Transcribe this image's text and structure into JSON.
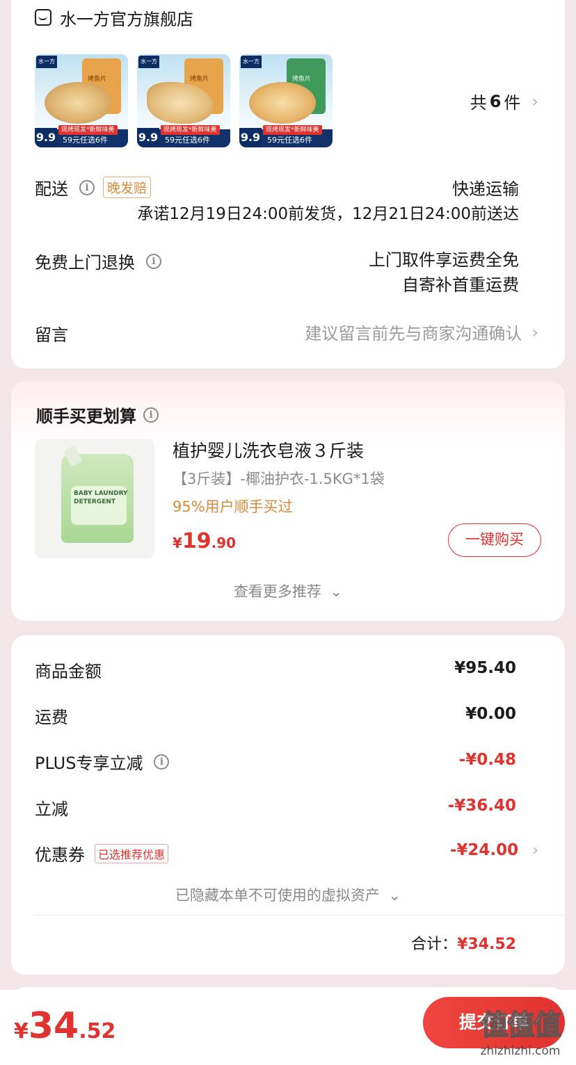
{
  "store": {
    "name": "水一方官方旗舰店",
    "item_count_prefix": "共",
    "item_count": "6",
    "item_count_suffix": "件",
    "thumbnails": [
      {
        "brand": "水一方",
        "bag_label": "烤鱼片",
        "tag": "现烤现发*新鲜味美",
        "promo": "59元任选6件",
        "price": "9.9"
      },
      {
        "brand": "水一方",
        "bag_label": "烤鱼片",
        "tag": "现烤现发*新鲜味美",
        "promo": "59元任选6件",
        "price": "9.9"
      },
      {
        "brand": "水一方",
        "bag_label": "烤鱼片",
        "tag": "现烤现发*新鲜味美",
        "promo": "59元任选6件",
        "price": "9.9"
      }
    ]
  },
  "delivery": {
    "label": "配送",
    "badge": "晚发赔",
    "method": "快递运输",
    "promise": "承诺12月19日24:00前发货，12月21日24:00前送达"
  },
  "returns": {
    "label": "免费上门退换",
    "line1": "上门取件享运费全免",
    "line2": "自寄补首重运费"
  },
  "message": {
    "label": "留言",
    "placeholder": "建议留言前先与商家沟通确认"
  },
  "upsell": {
    "title": "顺手买更划算",
    "product_name": "植护婴儿洗衣皂液３斤装",
    "spec": "【3斤装】-椰油护衣-1.5KG*1袋",
    "social": "95%用户顺手买过",
    "price_symbol": "¥",
    "price_int": "19",
    "price_dec": ".90",
    "buy_button": "一键购买",
    "more": "查看更多推荐"
  },
  "summary": {
    "rows": [
      {
        "label": "商品金额",
        "value": "¥95.40"
      },
      {
        "label": "运费",
        "value": "¥0.00"
      },
      {
        "label": "PLUS专享立减",
        "value": "-¥0.48"
      },
      {
        "label": "立减",
        "value": "-¥36.40"
      },
      {
        "label": "优惠券",
        "badge": "已选推荐优惠",
        "value": "-¥24.00"
      }
    ],
    "hidden_assets": "已隐藏本单不可使用的虚拟资产",
    "total_label": "合计：",
    "total_value": "¥34.52"
  },
  "footer": {
    "price_symbol": "¥",
    "price_int": "34",
    "price_dec": ".52",
    "submit": "提交订单",
    "watermark": "值|什么值得买",
    "watermark_url": "zhizhizhi.com"
  },
  "colors": {
    "accent": "#e0322e",
    "orange": "#d98a3a"
  }
}
